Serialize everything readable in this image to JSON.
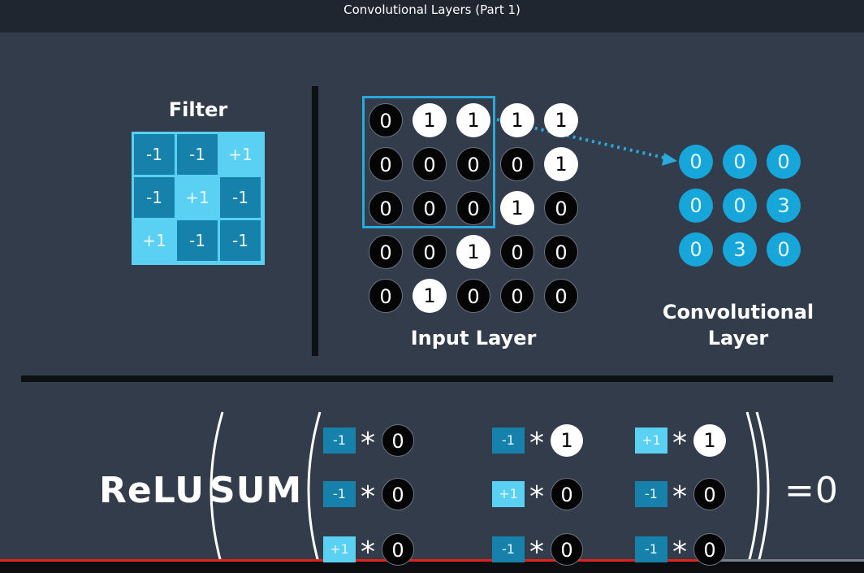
{
  "window": {
    "title": "Convolutional Layers (Part 1)"
  },
  "filter": {
    "label": "Filter",
    "cells": [
      [
        "-1",
        "-1",
        "+1"
      ],
      [
        "-1",
        "+1",
        "-1"
      ],
      [
        "+1",
        "-1",
        "-1"
      ]
    ]
  },
  "input_layer": {
    "label": "Input Layer",
    "values": [
      [
        "0",
        "1",
        "1",
        "1",
        "1"
      ],
      [
        "0",
        "0",
        "0",
        "0",
        "1"
      ],
      [
        "0",
        "0",
        "0",
        "1",
        "0"
      ],
      [
        "0",
        "0",
        "1",
        "0",
        "0"
      ],
      [
        "0",
        "1",
        "0",
        "0",
        "0"
      ]
    ]
  },
  "conv_layer": {
    "label_line1": "Convolutional",
    "label_line2": "Layer",
    "values": [
      [
        "0",
        "0",
        "0"
      ],
      [
        "0",
        "0",
        "3"
      ],
      [
        "0",
        "3",
        "0"
      ]
    ]
  },
  "equation": {
    "relu": "ReLU",
    "sum": "SUM",
    "star": "*",
    "result": "=0",
    "terms": [
      {
        "w": "-1",
        "x": "0"
      },
      {
        "w": "-1",
        "x": "1"
      },
      {
        "w": "+1",
        "x": "1"
      },
      {
        "w": "-1",
        "x": "0"
      },
      {
        "w": "+1",
        "x": "0"
      },
      {
        "w": "-1",
        "x": "0"
      },
      {
        "w": "+1",
        "x": "0"
      },
      {
        "w": "-1",
        "x": "0"
      },
      {
        "w": "-1",
        "x": "0"
      }
    ]
  },
  "video": {
    "progress": 0.82
  },
  "colors": {
    "background": "#323c4a",
    "accent": "#16a6da",
    "filter_light": "#5ad0f2",
    "filter_dark": "#1682ab",
    "progress": "#e62117"
  }
}
